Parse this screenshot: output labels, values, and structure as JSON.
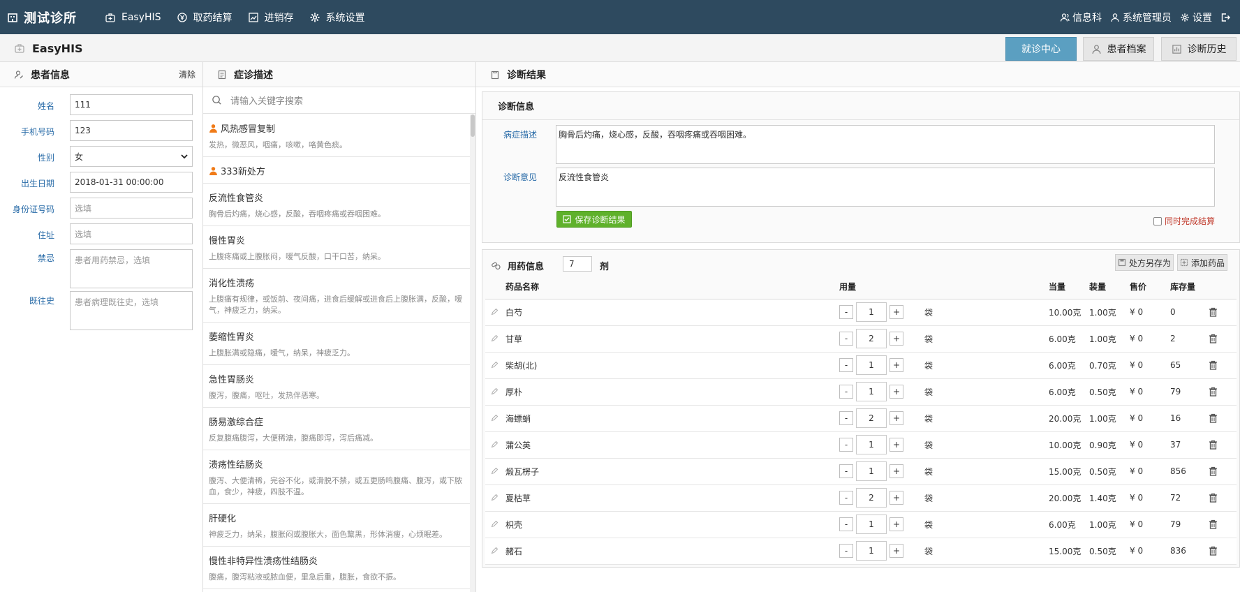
{
  "topbar": {
    "brand": "测试诊所",
    "nav": [
      {
        "label": "EasyHIS"
      },
      {
        "label": "取药结算"
      },
      {
        "label": "进销存"
      },
      {
        "label": "系统设置"
      }
    ],
    "right": {
      "dept": "信息科",
      "user": "系统管理员",
      "settings": "设置"
    }
  },
  "subheader": {
    "title": "EasyHIS",
    "tabs": [
      {
        "label": "就诊中心",
        "active": true
      },
      {
        "label": "患者档案",
        "active": false
      },
      {
        "label": "诊断历史",
        "active": false
      }
    ]
  },
  "patient": {
    "header": "患者信息",
    "clear": "清除",
    "fields": [
      {
        "label": "姓名",
        "value": "111",
        "placeholder": ""
      },
      {
        "label": "手机号码",
        "value": "123",
        "placeholder": ""
      },
      {
        "label": "性别",
        "value": "女",
        "placeholder": ""
      },
      {
        "label": "出生日期",
        "value": "2018-01-31 00:00:00",
        "placeholder": ""
      },
      {
        "label": "身份证号码",
        "value": "",
        "placeholder": "选填"
      },
      {
        "label": "住址",
        "value": "",
        "placeholder": "选填"
      },
      {
        "label": "禁忌",
        "value": "",
        "placeholder": "患者用药禁忌，选填"
      },
      {
        "label": "既往史",
        "value": "",
        "placeholder": "患者病理既往史，选填"
      }
    ]
  },
  "symptoms": {
    "header": "症诊描述",
    "search_placeholder": "请输入关键字搜索",
    "items": [
      {
        "name": "风热感冒复制",
        "desc": "发热，微恶风，咽痛，咳嗽，咯黄色痰。",
        "personal": true
      },
      {
        "name": "333新处方",
        "desc": "",
        "personal": true
      },
      {
        "name": "反流性食管炎",
        "desc": "胸骨后灼痛，烧心感，反酸，吞咽疼痛或吞咽困难。",
        "personal": false
      },
      {
        "name": "慢性胃炎",
        "desc": "上腹疼痛或上腹胀闷，嗳气反酸，口干口苦，纳呆。",
        "personal": false
      },
      {
        "name": "消化性溃疡",
        "desc": "上腹痛有规律，或饭前、夜间痛，进食后缓解或进食后上腹胀满，反酸，嗳气，神疲乏力，纳呆。",
        "personal": false
      },
      {
        "name": "萎缩性胃炎",
        "desc": "上腹胀满或隐痛，嗳气，纳呆，神疲乏力。",
        "personal": false
      },
      {
        "name": "急性胃肠炎",
        "desc": "腹泻，腹痛，呕吐，发热伴恶寒。",
        "personal": false
      },
      {
        "name": "肠易激综合症",
        "desc": "反复腹痛腹泻，大便稀溏，腹痛即泻，泻后痛减。",
        "personal": false
      },
      {
        "name": "溃疡性结肠炎",
        "desc": "腹泻、大便清稀，完谷不化，或滑脱不禁，或五更肠鸣腹痛、腹泻，或下脓血，食少，神疲，四肢不温。",
        "personal": false
      },
      {
        "name": "肝硬化",
        "desc": "神疲乏力，纳呆，腹胀闷或腹胀大，面色黧黑，形体消瘦，心烦眠差。",
        "personal": false
      },
      {
        "name": "慢性非特异性溃疡性结肠炎",
        "desc": "腹痛，腹泻粘液或脓血便，里急后重，腹胀，食欲不振。",
        "personal": false
      }
    ]
  },
  "diagnosis": {
    "header": "诊断结果",
    "info_title": "诊断信息",
    "symptom_label": "病症描述",
    "symptom_text": "胸骨后灼痛，烧心感，反酸，吞咽疼痛或吞咽困难。",
    "opinion_label": "诊断意见",
    "opinion_text": "反流性食管炎",
    "save_button": "保存诊断结果",
    "complete_checkbox": "同时完成结算"
  },
  "medication": {
    "title": "用药信息",
    "doses": "7",
    "dose_unit": "剂",
    "save_as": "处方另存为",
    "add_drug": "添加药品",
    "columns": {
      "name": "药品名称",
      "amount": "用量",
      "equiv": "当量",
      "pack": "装量",
      "price": "售价",
      "stock": "库存量"
    },
    "rows": [
      {
        "name": "白芍",
        "qty": "1",
        "unit": "袋",
        "equiv": "10.00克",
        "pack": "1.00克",
        "price": "¥ 0",
        "stock": "0"
      },
      {
        "name": "甘草",
        "qty": "2",
        "unit": "袋",
        "equiv": "6.00克",
        "pack": "1.00克",
        "price": "¥ 0",
        "stock": "2"
      },
      {
        "name": "柴胡(北)",
        "qty": "1",
        "unit": "袋",
        "equiv": "6.00克",
        "pack": "0.70克",
        "price": "¥ 0",
        "stock": "65"
      },
      {
        "name": "厚朴",
        "qty": "1",
        "unit": "袋",
        "equiv": "6.00克",
        "pack": "0.50克",
        "price": "¥ 0",
        "stock": "79"
      },
      {
        "name": "海螵蛸",
        "qty": "2",
        "unit": "袋",
        "equiv": "20.00克",
        "pack": "1.00克",
        "price": "¥ 0",
        "stock": "16"
      },
      {
        "name": "蒲公英",
        "qty": "1",
        "unit": "袋",
        "equiv": "10.00克",
        "pack": "0.90克",
        "price": "¥ 0",
        "stock": "37"
      },
      {
        "name": "煅瓦楞子",
        "qty": "1",
        "unit": "袋",
        "equiv": "15.00克",
        "pack": "0.50克",
        "price": "¥ 0",
        "stock": "856"
      },
      {
        "name": "夏枯草",
        "qty": "2",
        "unit": "袋",
        "equiv": "20.00克",
        "pack": "1.40克",
        "price": "¥ 0",
        "stock": "72"
      },
      {
        "name": "枳壳",
        "qty": "1",
        "unit": "袋",
        "equiv": "6.00克",
        "pack": "1.00克",
        "price": "¥ 0",
        "stock": "79"
      },
      {
        "name": "赭石",
        "qty": "1",
        "unit": "袋",
        "equiv": "15.00克",
        "pack": "0.50克",
        "price": "¥ 0",
        "stock": "836"
      }
    ]
  }
}
